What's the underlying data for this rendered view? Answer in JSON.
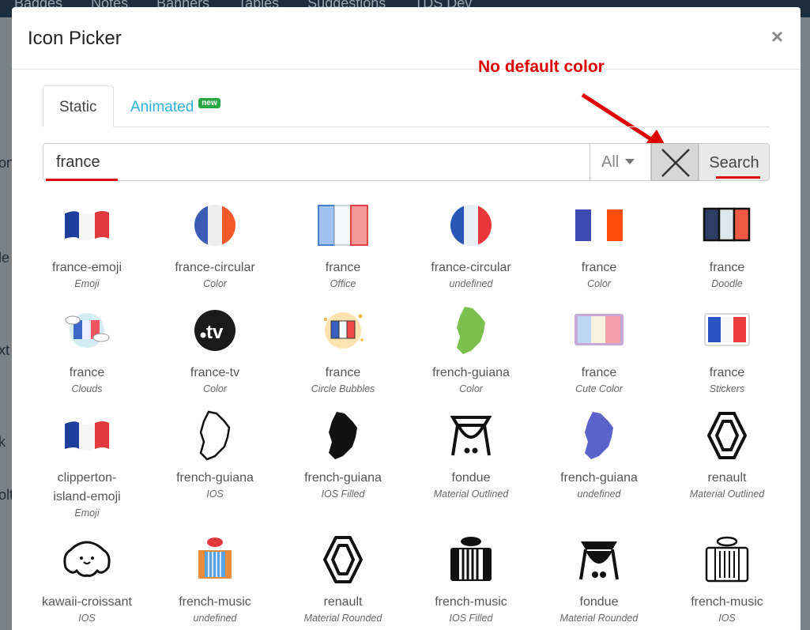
{
  "background": {
    "nav": [
      "Badges",
      "Notes",
      "Banners",
      "Tables",
      "Suggestions",
      "TDS Dev"
    ],
    "fragments": [
      "on",
      "le",
      "xt",
      "k",
      "olt"
    ]
  },
  "modal": {
    "title": "Icon Picker",
    "close_glyph": "×",
    "annotation": "No default color",
    "tabs": [
      {
        "label": "Static"
      },
      {
        "label": "Animated",
        "badge": "new"
      }
    ],
    "search": {
      "value": "france",
      "filter": "All",
      "button": "Search"
    },
    "icons": [
      {
        "name": "france-emoji",
        "style": "Emoji",
        "icon": "flag-wavy-icon"
      },
      {
        "name": "france-circular",
        "style": "Color",
        "icon": "flag-circle-icon"
      },
      {
        "name": "france",
        "style": "Office",
        "icon": "flag-office-icon"
      },
      {
        "name": "france-circular",
        "style": "undefined",
        "icon": "flag-circle-icon"
      },
      {
        "name": "france",
        "style": "Color",
        "icon": "flag-icon"
      },
      {
        "name": "france",
        "style": "Doodle",
        "icon": "flag-doodle-icon"
      },
      {
        "name": "france",
        "style": "Clouds",
        "icon": "flag-clouds-icon"
      },
      {
        "name": "france-tv",
        "style": "Color",
        "icon": "tv-logo-icon"
      },
      {
        "name": "france",
        "style": "Circle Bubbles",
        "icon": "flag-bubble-icon"
      },
      {
        "name": "french-guiana",
        "style": "Color",
        "icon": "map-guiana-icon"
      },
      {
        "name": "france",
        "style": "Cute Color",
        "icon": "flag-cute-icon"
      },
      {
        "name": "france",
        "style": "Stickers",
        "icon": "flag-sticker-icon"
      },
      {
        "name": "clipperton-island-emoji",
        "style": "Emoji",
        "icon": "flag-wavy-icon"
      },
      {
        "name": "french-guiana",
        "style": "IOS",
        "icon": "map-guiana-outline-icon"
      },
      {
        "name": "french-guiana",
        "style": "IOS Filled",
        "icon": "map-guiana-filled-icon"
      },
      {
        "name": "fondue",
        "style": "Material Outlined",
        "icon": "fondue-icon"
      },
      {
        "name": "french-guiana",
        "style": "undefined",
        "icon": "map-guiana-blue-icon"
      },
      {
        "name": "renault",
        "style": "Material Outlined",
        "icon": "renault-logo-icon"
      },
      {
        "name": "kawaii-croissant",
        "style": "IOS",
        "icon": "croissant-icon"
      },
      {
        "name": "french-music",
        "style": "undefined",
        "icon": "accordion-color-icon"
      },
      {
        "name": "renault",
        "style": "Material Rounded",
        "icon": "renault-logo-icon"
      },
      {
        "name": "french-music",
        "style": "IOS Filled",
        "icon": "accordion-filled-icon"
      },
      {
        "name": "fondue",
        "style": "Material Rounded",
        "icon": "fondue-filled-icon"
      },
      {
        "name": "french-music",
        "style": "IOS",
        "icon": "accordion-outline-icon"
      }
    ]
  }
}
